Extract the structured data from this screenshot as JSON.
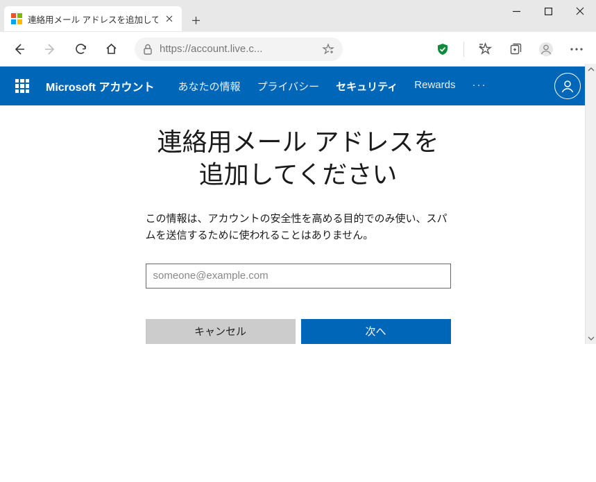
{
  "window": {
    "tab_title": "連絡用メール アドレスを追加してくださ"
  },
  "addressbar": {
    "url": "https://account.live.c..."
  },
  "nav": {
    "brand": "Microsoft アカウント",
    "items": [
      "あなたの情報",
      "プライバシー",
      "セキュリティ",
      "Rewards"
    ],
    "active_index": 2
  },
  "page": {
    "title": "連絡用メール アドレスを追加してください",
    "description": "この情報は、アカウントの安全性を高める目的でのみ使い、スパムを送信するために使われることはありません。",
    "email_placeholder": "someone@example.com",
    "email_value": "",
    "cancel_label": "キャンセル",
    "next_label": "次へ"
  }
}
